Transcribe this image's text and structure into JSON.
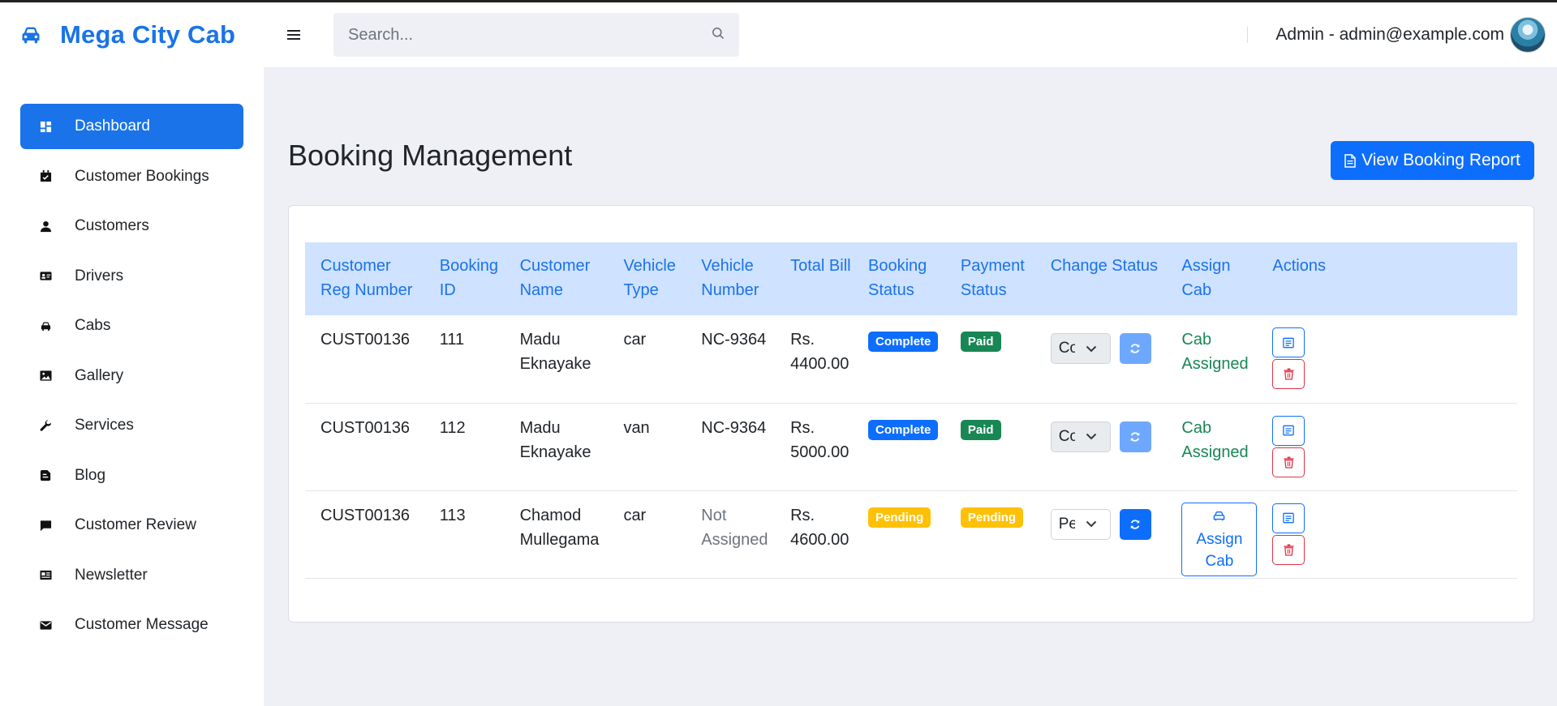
{
  "header": {
    "brand": "Mega City Cab",
    "search_placeholder": "Search...",
    "user_label": "Admin - admin@example.com"
  },
  "sidebar": {
    "items": [
      {
        "label": "Dashboard",
        "icon": "dashboard-icon",
        "active": true
      },
      {
        "label": "Customer Bookings",
        "icon": "calendar-check-icon"
      },
      {
        "label": "Customers",
        "icon": "person-icon"
      },
      {
        "label": "Drivers",
        "icon": "id-card-icon"
      },
      {
        "label": "Cabs",
        "icon": "car-icon"
      },
      {
        "label": "Gallery",
        "icon": "image-icon"
      },
      {
        "label": "Services",
        "icon": "wrench-icon"
      },
      {
        "label": "Blog",
        "icon": "blog-icon"
      },
      {
        "label": "Customer Review",
        "icon": "chat-icon"
      },
      {
        "label": "Newsletter",
        "icon": "newspaper-icon"
      },
      {
        "label": "Customer Message",
        "icon": "envelope-icon"
      }
    ]
  },
  "main": {
    "title": "Booking Management",
    "report_button": "View Booking Report"
  },
  "table": {
    "headers": {
      "reg": "Customer Reg Number",
      "booking_id": "Booking ID",
      "name": "Customer Name",
      "vehicle_type": "Vehicle Type",
      "vehicle_number": "Vehicle Number",
      "total": "Total Bill",
      "booking_status": "Booking Status",
      "payment_status": "Payment Status",
      "change_status": "Change Status",
      "assign_cab": "Assign Cab",
      "actions": "Actions"
    },
    "rows": [
      {
        "reg": "CUST00136",
        "booking_id": "111",
        "name": "Madu Eknayake",
        "vehicle_type": "car",
        "vehicle_number": "NC-9364",
        "total": "Rs. 4400.00",
        "booking_status": "Complete",
        "payment_status": "Paid",
        "change_status": "Complete",
        "assign": "Cab Assigned"
      },
      {
        "reg": "CUST00136",
        "booking_id": "112",
        "name": "Madu Eknayake",
        "vehicle_type": "van",
        "vehicle_number": "NC-9364",
        "total": "Rs. 5000.00",
        "booking_status": "Complete",
        "payment_status": "Paid",
        "change_status": "Complete",
        "assign": "Cab Assigned"
      },
      {
        "reg": "CUST00136",
        "booking_id": "113",
        "name": "Chamod Mullegama",
        "vehicle_type": "car",
        "vehicle_number": "Not Assigned",
        "total": "Rs. 4600.00",
        "booking_status": "Pending",
        "payment_status": "Pending",
        "change_status": "Pending",
        "assign": "Assign Cab"
      }
    ]
  },
  "colors": {
    "brand": "#1a73e8",
    "primary": "#0d6efd",
    "success": "#198754",
    "warning": "#ffc107",
    "danger": "#dc3545",
    "table_header_bg": "#cfe2ff"
  }
}
